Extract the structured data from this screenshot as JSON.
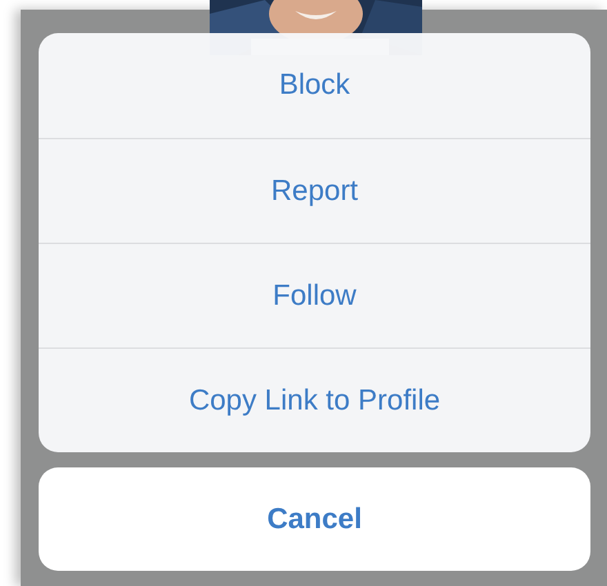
{
  "action_sheet": {
    "actions": [
      {
        "label": "Block"
      },
      {
        "label": "Report"
      },
      {
        "label": "Follow"
      },
      {
        "label": "Copy Link to Profile"
      }
    ],
    "cancel": {
      "label": "Cancel"
    }
  }
}
